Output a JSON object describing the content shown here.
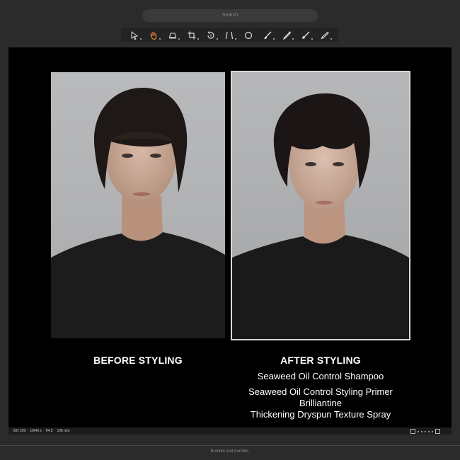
{
  "search": {
    "placeholder": "Search"
  },
  "toolbar": {
    "tools": [
      {
        "icon": "cursor-icon",
        "active": false
      },
      {
        "icon": "hand-pan-icon",
        "active": true
      },
      {
        "icon": "bucket-icon",
        "active": false
      },
      {
        "icon": "crop-icon",
        "active": false
      },
      {
        "icon": "rotate-icon",
        "active": false
      },
      {
        "icon": "keystone-icon",
        "active": false
      },
      {
        "icon": "ellipse-icon",
        "active": false
      },
      {
        "icon": "brush-icon",
        "active": false
      },
      {
        "icon": "eyedropper-icon",
        "active": false
      },
      {
        "icon": "arrow-pen-icon",
        "active": false
      },
      {
        "icon": "pen-icon",
        "active": false
      }
    ],
    "active_color": "#e8833a"
  },
  "viewer": {
    "before_caption": "BEFORE STYLING",
    "after_caption": "AFTER STYLING",
    "products": [
      "Seaweed Oil Control Shampoo",
      "Seaweed Oil Control Styling Primer",
      "Brilliantine",
      "Thickening Dryspun Texture Spray"
    ]
  },
  "status": {
    "iso": "ISO 200",
    "shutter": "1/640 s",
    "aperture": "f/4.5",
    "focal": "106 mm"
  },
  "footer": {
    "caption": "Bumble and bumble."
  }
}
